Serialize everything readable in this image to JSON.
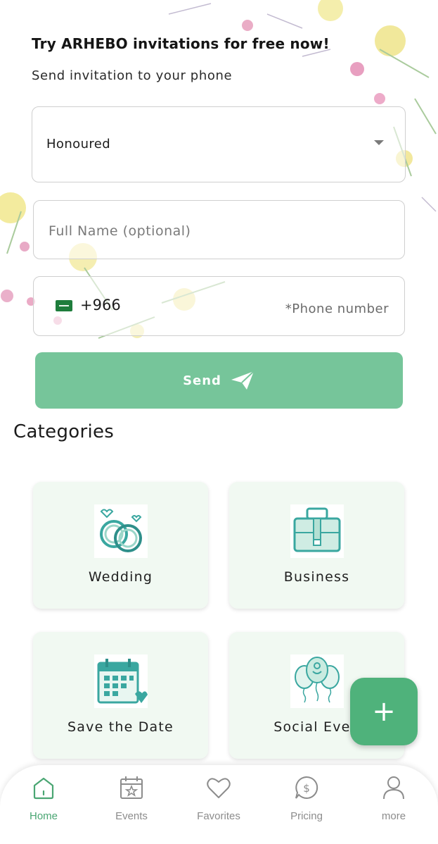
{
  "promo": {
    "headline": "Try ARHEBO invitations for free now!",
    "subline": "Send invitation to your phone"
  },
  "form": {
    "title_select": {
      "selected": "Honoured"
    },
    "full_name": {
      "placeholder": "Full Name (optional)"
    },
    "phone": {
      "dial_code": "+966",
      "placeholder": "*Phone number",
      "flag": "saudi-arabia-flag-icon"
    },
    "send_label": "Send"
  },
  "categories": {
    "title": "Categories",
    "items": [
      {
        "label": "Wedding",
        "icon": "rings-icon"
      },
      {
        "label": "Business",
        "icon": "briefcase-icon"
      },
      {
        "label": "Save the Date",
        "icon": "calendar-heart-icon"
      },
      {
        "label": "Social Even",
        "icon": "balloons-icon"
      }
    ]
  },
  "fab": {
    "label": "+"
  },
  "nav": {
    "items": [
      {
        "label": "Home",
        "icon": "home-icon",
        "active": true
      },
      {
        "label": "Events",
        "icon": "calendar-star-icon",
        "active": false
      },
      {
        "label": "Favorites",
        "icon": "heart-icon",
        "active": false
      },
      {
        "label": "Pricing",
        "icon": "dollar-coin-icon",
        "active": false
      },
      {
        "label": "more",
        "icon": "user-icon",
        "active": false
      }
    ]
  },
  "colors": {
    "accent": "#4fb27b",
    "send_button": "#76c59a",
    "card_bg": "#f1f9f2",
    "nav_active": "#4aa673",
    "icon_teal": "#3aa7a0"
  }
}
